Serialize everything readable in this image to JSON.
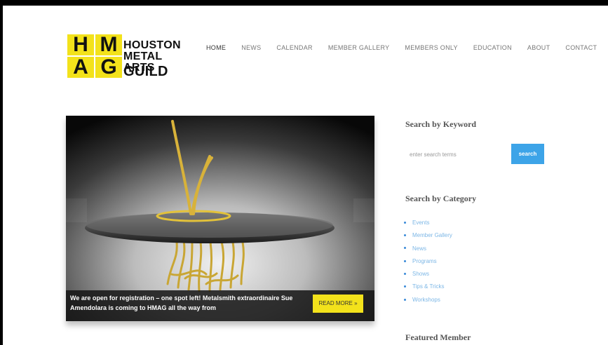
{
  "logo": {
    "letters": [
      "H",
      "M",
      "A",
      "G"
    ],
    "name_lines": [
      "HOUSTON",
      "METAL ARTS",
      "GUILD"
    ]
  },
  "nav": {
    "items": [
      {
        "label": "HOME",
        "active": true
      },
      {
        "label": "NEWS"
      },
      {
        "label": "CALENDAR"
      },
      {
        "label": "MEMBER GALLERY"
      },
      {
        "label": "MEMBERS ONLY"
      },
      {
        "label": "EDUCATION"
      },
      {
        "label": "ABOUT"
      },
      {
        "label": "CONTACT"
      }
    ]
  },
  "hero": {
    "caption": "We are open for registration – one spot left! Metalsmith extraordinaire Sue Amendolara is coming to HMAG all the way from",
    "read_more": "READ MORE »"
  },
  "sidebar": {
    "keyword_heading": "Search by Keyword",
    "search_placeholder": "enter search terms",
    "search_button": "search",
    "category_heading": "Search by Category",
    "categories": [
      "Events",
      "Member Gallery",
      "News",
      "Programs",
      "Shows",
      "Tips & Tricks",
      "Workshops"
    ],
    "featured_heading": "Featured Member"
  },
  "colors": {
    "logo_yellow": "#f3e21b",
    "search_button": "#3da4e8",
    "category_link": "#7db7e6"
  }
}
